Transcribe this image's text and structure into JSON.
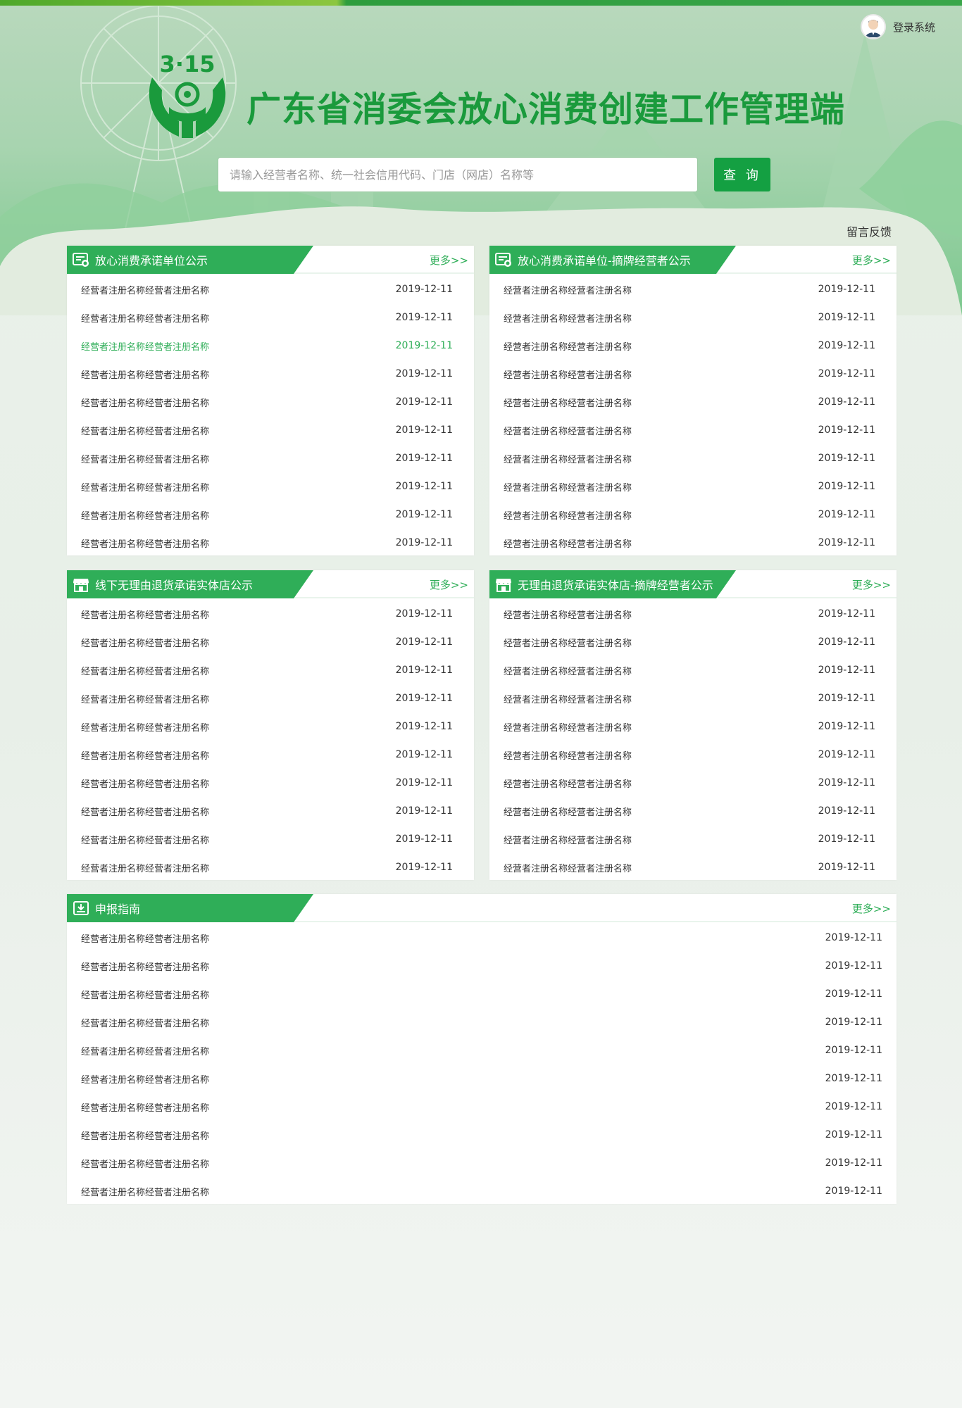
{
  "header": {
    "title": "广东省消委会放心消费创建工作管理端",
    "logo_text": "3·15",
    "login_label": "登录系统"
  },
  "search": {
    "placeholder": "请输入经营者名称、统一社会信用代码、门店（网店）名称等",
    "button_label": "查 询"
  },
  "feedback_label": "留言反馈",
  "colors": {
    "accent": "#2fae58",
    "brand": "#1a9a3c"
  },
  "panels": [
    {
      "title": "放心消费承诺单位公示",
      "icon": "document-icon",
      "more_label": "更多>>",
      "items": [
        {
          "name": "经营者注册名称经营者注册名称",
          "date": "2019-12-11"
        },
        {
          "name": "经营者注册名称经营者注册名称",
          "date": "2019-12-11"
        },
        {
          "name": "经营者注册名称经营者注册名称",
          "date": "2019-12-11"
        },
        {
          "name": "经营者注册名称经营者注册名称",
          "date": "2019-12-11"
        },
        {
          "name": "经营者注册名称经营者注册名称",
          "date": "2019-12-11"
        },
        {
          "name": "经营者注册名称经营者注册名称",
          "date": "2019-12-11"
        },
        {
          "name": "经营者注册名称经营者注册名称",
          "date": "2019-12-11"
        },
        {
          "name": "经营者注册名称经营者注册名称",
          "date": "2019-12-11"
        },
        {
          "name": "经营者注册名称经营者注册名称",
          "date": "2019-12-11"
        },
        {
          "name": "经营者注册名称经营者注册名称",
          "date": "2019-12-11"
        }
      ]
    },
    {
      "title": "放心消费承诺单位-摘牌经营者公示",
      "icon": "document-icon",
      "more_label": "更多>>",
      "items": [
        {
          "name": "经营者注册名称经营者注册名称",
          "date": "2019-12-11"
        },
        {
          "name": "经营者注册名称经营者注册名称",
          "date": "2019-12-11"
        },
        {
          "name": "经营者注册名称经营者注册名称",
          "date": "2019-12-11"
        },
        {
          "name": "经营者注册名称经营者注册名称",
          "date": "2019-12-11"
        },
        {
          "name": "经营者注册名称经营者注册名称",
          "date": "2019-12-11"
        },
        {
          "name": "经营者注册名称经营者注册名称",
          "date": "2019-12-11"
        },
        {
          "name": "经营者注册名称经营者注册名称",
          "date": "2019-12-11"
        },
        {
          "name": "经营者注册名称经营者注册名称",
          "date": "2019-12-11"
        },
        {
          "name": "经营者注册名称经营者注册名称",
          "date": "2019-12-11"
        },
        {
          "name": "经营者注册名称经营者注册名称",
          "date": "2019-12-11"
        }
      ]
    },
    {
      "title": "线下无理由退货承诺实体店公示",
      "icon": "store-icon",
      "more_label": "更多>>",
      "items": [
        {
          "name": "经营者注册名称经营者注册名称",
          "date": "2019-12-11"
        },
        {
          "name": "经营者注册名称经营者注册名称",
          "date": "2019-12-11"
        },
        {
          "name": "经营者注册名称经营者注册名称",
          "date": "2019-12-11"
        },
        {
          "name": "经营者注册名称经营者注册名称",
          "date": "2019-12-11"
        },
        {
          "name": "经营者注册名称经营者注册名称",
          "date": "2019-12-11"
        },
        {
          "name": "经营者注册名称经营者注册名称",
          "date": "2019-12-11"
        },
        {
          "name": "经营者注册名称经营者注册名称",
          "date": "2019-12-11"
        },
        {
          "name": "经营者注册名称经营者注册名称",
          "date": "2019-12-11"
        },
        {
          "name": "经营者注册名称经营者注册名称",
          "date": "2019-12-11"
        },
        {
          "name": "经营者注册名称经营者注册名称",
          "date": "2019-12-11"
        }
      ]
    },
    {
      "title": "无理由退货承诺实体店-摘牌经营者公示",
      "icon": "store-icon",
      "more_label": "更多>>",
      "items": [
        {
          "name": "经营者注册名称经营者注册名称",
          "date": "2019-12-11"
        },
        {
          "name": "经营者注册名称经营者注册名称",
          "date": "2019-12-11"
        },
        {
          "name": "经营者注册名称经营者注册名称",
          "date": "2019-12-11"
        },
        {
          "name": "经营者注册名称经营者注册名称",
          "date": "2019-12-11"
        },
        {
          "name": "经营者注册名称经营者注册名称",
          "date": "2019-12-11"
        },
        {
          "name": "经营者注册名称经营者注册名称",
          "date": "2019-12-11"
        },
        {
          "name": "经营者注册名称经营者注册名称",
          "date": "2019-12-11"
        },
        {
          "name": "经营者注册名称经营者注册名称",
          "date": "2019-12-11"
        },
        {
          "name": "经营者注册名称经营者注册名称",
          "date": "2019-12-11"
        },
        {
          "name": "经营者注册名称经营者注册名称",
          "date": "2019-12-11"
        }
      ]
    },
    {
      "title": "申报指南",
      "icon": "download-icon",
      "more_label": "更多>>",
      "items": [
        {
          "name": "经营者注册名称经营者注册名称",
          "date": "2019-12-11"
        },
        {
          "name": "经营者注册名称经营者注册名称",
          "date": "2019-12-11"
        },
        {
          "name": "经营者注册名称经营者注册名称",
          "date": "2019-12-11"
        },
        {
          "name": "经营者注册名称经营者注册名称",
          "date": "2019-12-11"
        },
        {
          "name": "经营者注册名称经营者注册名称",
          "date": "2019-12-11"
        },
        {
          "name": "经营者注册名称经营者注册名称",
          "date": "2019-12-11"
        },
        {
          "name": "经营者注册名称经营者注册名称",
          "date": "2019-12-11"
        },
        {
          "name": "经营者注册名称经营者注册名称",
          "date": "2019-12-11"
        },
        {
          "name": "经营者注册名称经营者注册名称",
          "date": "2019-12-11"
        },
        {
          "name": "经营者注册名称经营者注册名称",
          "date": "2019-12-11"
        }
      ]
    }
  ]
}
